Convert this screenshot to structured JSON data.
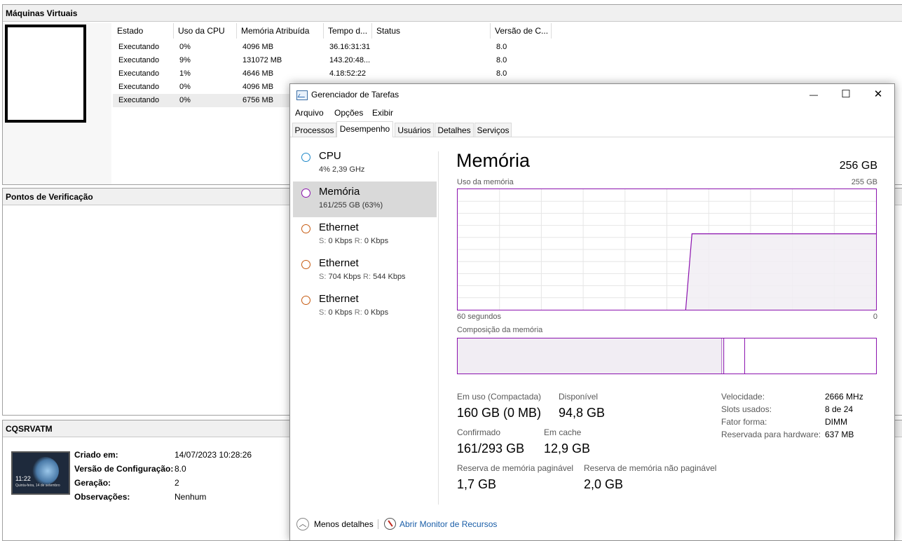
{
  "hyperv": {
    "vm_panel_title": "Máquinas Virtuais",
    "columns": [
      "Estado",
      "Uso da CPU",
      "Memória Atribuída",
      "Tempo d...",
      "Status",
      "Versão de C..."
    ],
    "rows": [
      {
        "estado": "Executando",
        "cpu": "0%",
        "mem": "4096 MB",
        "tempo": "36.16:31:31",
        "status": "",
        "versao": "8.0"
      },
      {
        "estado": "Executando",
        "cpu": "9%",
        "mem": "131072 MB",
        "tempo": "143.20:48...",
        "status": "",
        "versao": "8.0"
      },
      {
        "estado": "Executando",
        "cpu": "1%",
        "mem": "4646 MB",
        "tempo": "4.18:52:22",
        "status": "",
        "versao": "8.0"
      },
      {
        "estado": "Executando",
        "cpu": "0%",
        "mem": "4096 MB",
        "tempo": "",
        "status": "",
        "versao": ""
      },
      {
        "estado": "Executando",
        "cpu": "0%",
        "mem": "6756 MB",
        "tempo": "",
        "status": "",
        "versao": ""
      }
    ],
    "checkpoints_title": "Pontos de Verificação",
    "details_title": "CQSRVATM",
    "details": {
      "thumb_time": "11:22",
      "thumb_sub": "Quinta-feira, 14 de setembro",
      "created_label": "Criado em:",
      "created_value": "14/07/2023 10:28:26",
      "config_label": "Versão de Configuração:",
      "config_value": "8.0",
      "gen_label": "Geração:",
      "gen_value": "2",
      "notes_label": "Observações:",
      "notes_value": "Nenhum"
    }
  },
  "taskmgr": {
    "title": "Gerenciador de Tarefas",
    "window_buttons": {
      "minimize": "—",
      "maximize": "☐",
      "close": "✕"
    },
    "menu": [
      "Arquivo",
      "Opções",
      "Exibir"
    ],
    "tabs": [
      "Processos",
      "Desempenho",
      "Usuários",
      "Detalhes",
      "Serviços"
    ],
    "active_tab": "Desempenho",
    "sidebar": [
      {
        "name": "CPU",
        "sub": "4% 2,39 GHz",
        "color": "#1e88c8"
      },
      {
        "name": "Memória",
        "sub": "161/255 GB (63%)",
        "color": "#8b12ae"
      },
      {
        "name": "Ethernet",
        "sub_s_label": "S:",
        "sub_s": "0 Kbps",
        "sub_r_label": "R:",
        "sub_r": "0 Kbps",
        "color": "#c65a10"
      },
      {
        "name": "Ethernet",
        "sub_s_label": "S:",
        "sub_s": "704 Kbps",
        "sub_r_label": "R:",
        "sub_r": "544 Kbps",
        "color": "#c65a10"
      },
      {
        "name": "Ethernet",
        "sub_s_label": "S:",
        "sub_s": "0 Kbps",
        "sub_r_label": "R:",
        "sub_r": "0 Kbps",
        "color": "#c65a10"
      }
    ],
    "perf": {
      "title": "Memória",
      "total": "256 GB",
      "usage_label": "Uso da memória",
      "usage_max": "255 GB",
      "x_left": "60 segundos",
      "x_right": "0",
      "usage_level_fraction": 0.63,
      "composition_label": "Composição da memória",
      "composition": {
        "in_use_fraction": 0.631,
        "modified_fraction": 0.005,
        "standby_fraction": 0.05
      },
      "stats": {
        "in_use_label": "Em uso (Compactada)",
        "in_use_value": "160 GB (0 MB)",
        "available_label": "Disponível",
        "available_value": "94,8 GB",
        "committed_label": "Confirmado",
        "committed_value": "161/293 GB",
        "cached_label": "Em cache",
        "cached_value": "12,9 GB",
        "paged_label": "Reserva de memória paginável",
        "paged_value": "1,7 GB",
        "nonpaged_label": "Reserva de memória não paginável",
        "nonpaged_value": "2,0 GB"
      },
      "info": [
        {
          "label": "Velocidade:",
          "value": "2666 MHz"
        },
        {
          "label": "Slots usados:",
          "value": "8 de 24"
        },
        {
          "label": "Fator forma:",
          "value": "DIMM"
        },
        {
          "label": "Reservada para hardware:",
          "value": "637 MB"
        }
      ]
    },
    "footer": {
      "fewer_details": "Menos detalhes",
      "open_resmon": "Abrir Monitor de Recursos"
    },
    "colors": {
      "memory": "#8b12ae",
      "memory_fill": "#f1edf3",
      "selected": "#d9d9d9"
    }
  }
}
